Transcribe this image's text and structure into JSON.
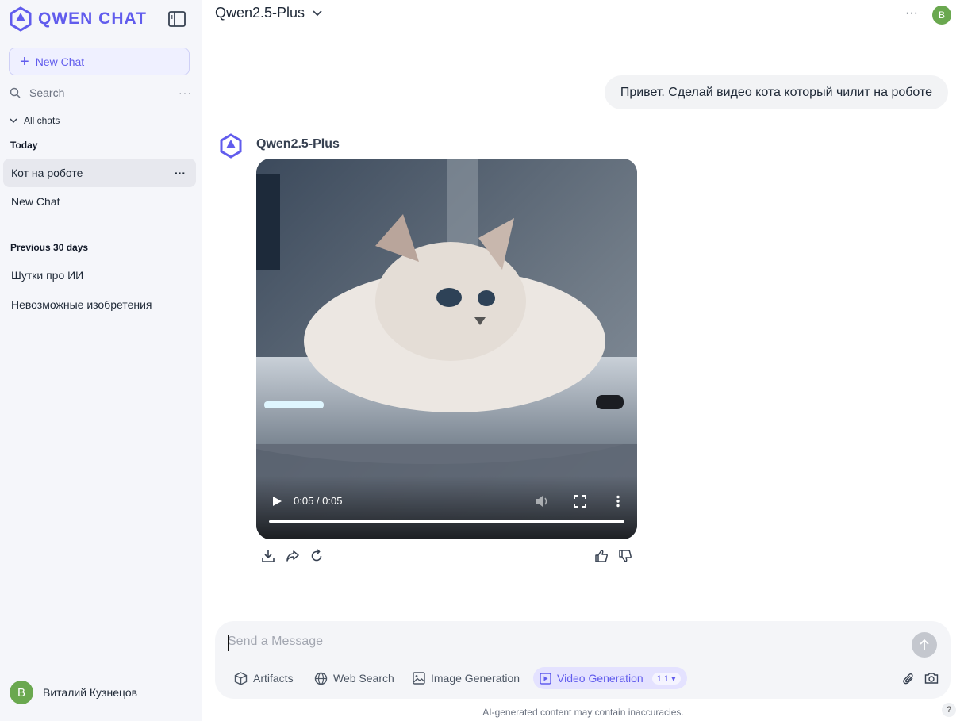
{
  "brand": {
    "name": "QWEN CHAT",
    "color": "#615ced"
  },
  "sidebar": {
    "new_chat_label": "New Chat",
    "search_label": "Search",
    "search_more": "···",
    "all_chats_label": "All chats",
    "sections": [
      {
        "title": "Today",
        "items": [
          {
            "label": "Кот на роботе",
            "active": true,
            "more": "···"
          },
          {
            "label": "New Chat"
          }
        ]
      },
      {
        "title": "Previous 30 days",
        "items": [
          {
            "label": "Шутки про ИИ"
          },
          {
            "label": "Невозможные изобретения"
          }
        ]
      }
    ],
    "user": {
      "avatar_letter": "B",
      "name": "Виталий Кузнецов"
    }
  },
  "header": {
    "model_name": "Qwen2.5-Plus",
    "more": "···",
    "avatar_letter": "B"
  },
  "conversation": {
    "user_message": "Привет. Сделай видео кота который чилит на роботе",
    "bot_name": "Qwen2.5-Plus",
    "video": {
      "time": "0:05 / 0:05",
      "progress": 1.0
    },
    "actions": [
      "download-icon",
      "share-icon",
      "regenerate-icon",
      "thumbs-up-icon",
      "thumbs-down-icon"
    ]
  },
  "composer": {
    "placeholder": "Send a Message",
    "tools": [
      {
        "label": "Artifacts",
        "icon": "cube-icon"
      },
      {
        "label": "Web Search",
        "icon": "globe-icon"
      },
      {
        "label": "Image Generation",
        "icon": "image-icon"
      },
      {
        "label": "Video Generation",
        "icon": "video-icon",
        "active": true,
        "ratio": "1:1"
      }
    ]
  },
  "footer": {
    "disclaimer": "AI-generated content may contain inaccuracies.",
    "help": "?"
  },
  "colors": {
    "accent": "#615ced",
    "avatar_green": "#6aa84f",
    "sidebar_bg": "#f5f6fa"
  }
}
